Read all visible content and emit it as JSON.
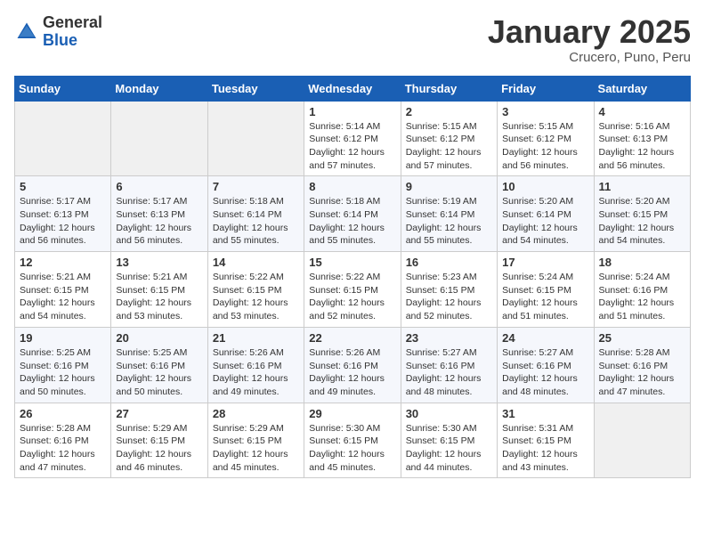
{
  "header": {
    "logo_general": "General",
    "logo_blue": "Blue",
    "title": "January 2025",
    "location": "Crucero, Puno, Peru"
  },
  "days_of_week": [
    "Sunday",
    "Monday",
    "Tuesday",
    "Wednesday",
    "Thursday",
    "Friday",
    "Saturday"
  ],
  "weeks": [
    [
      {
        "day": "",
        "info": ""
      },
      {
        "day": "",
        "info": ""
      },
      {
        "day": "",
        "info": ""
      },
      {
        "day": "1",
        "info": "Sunrise: 5:14 AM\nSunset: 6:12 PM\nDaylight: 12 hours and 57 minutes."
      },
      {
        "day": "2",
        "info": "Sunrise: 5:15 AM\nSunset: 6:12 PM\nDaylight: 12 hours and 57 minutes."
      },
      {
        "day": "3",
        "info": "Sunrise: 5:15 AM\nSunset: 6:12 PM\nDaylight: 12 hours and 56 minutes."
      },
      {
        "day": "4",
        "info": "Sunrise: 5:16 AM\nSunset: 6:13 PM\nDaylight: 12 hours and 56 minutes."
      }
    ],
    [
      {
        "day": "5",
        "info": "Sunrise: 5:17 AM\nSunset: 6:13 PM\nDaylight: 12 hours and 56 minutes."
      },
      {
        "day": "6",
        "info": "Sunrise: 5:17 AM\nSunset: 6:13 PM\nDaylight: 12 hours and 56 minutes."
      },
      {
        "day": "7",
        "info": "Sunrise: 5:18 AM\nSunset: 6:14 PM\nDaylight: 12 hours and 55 minutes."
      },
      {
        "day": "8",
        "info": "Sunrise: 5:18 AM\nSunset: 6:14 PM\nDaylight: 12 hours and 55 minutes."
      },
      {
        "day": "9",
        "info": "Sunrise: 5:19 AM\nSunset: 6:14 PM\nDaylight: 12 hours and 55 minutes."
      },
      {
        "day": "10",
        "info": "Sunrise: 5:20 AM\nSunset: 6:14 PM\nDaylight: 12 hours and 54 minutes."
      },
      {
        "day": "11",
        "info": "Sunrise: 5:20 AM\nSunset: 6:15 PM\nDaylight: 12 hours and 54 minutes."
      }
    ],
    [
      {
        "day": "12",
        "info": "Sunrise: 5:21 AM\nSunset: 6:15 PM\nDaylight: 12 hours and 54 minutes."
      },
      {
        "day": "13",
        "info": "Sunrise: 5:21 AM\nSunset: 6:15 PM\nDaylight: 12 hours and 53 minutes."
      },
      {
        "day": "14",
        "info": "Sunrise: 5:22 AM\nSunset: 6:15 PM\nDaylight: 12 hours and 53 minutes."
      },
      {
        "day": "15",
        "info": "Sunrise: 5:22 AM\nSunset: 6:15 PM\nDaylight: 12 hours and 52 minutes."
      },
      {
        "day": "16",
        "info": "Sunrise: 5:23 AM\nSunset: 6:15 PM\nDaylight: 12 hours and 52 minutes."
      },
      {
        "day": "17",
        "info": "Sunrise: 5:24 AM\nSunset: 6:15 PM\nDaylight: 12 hours and 51 minutes."
      },
      {
        "day": "18",
        "info": "Sunrise: 5:24 AM\nSunset: 6:16 PM\nDaylight: 12 hours and 51 minutes."
      }
    ],
    [
      {
        "day": "19",
        "info": "Sunrise: 5:25 AM\nSunset: 6:16 PM\nDaylight: 12 hours and 50 minutes."
      },
      {
        "day": "20",
        "info": "Sunrise: 5:25 AM\nSunset: 6:16 PM\nDaylight: 12 hours and 50 minutes."
      },
      {
        "day": "21",
        "info": "Sunrise: 5:26 AM\nSunset: 6:16 PM\nDaylight: 12 hours and 49 minutes."
      },
      {
        "day": "22",
        "info": "Sunrise: 5:26 AM\nSunset: 6:16 PM\nDaylight: 12 hours and 49 minutes."
      },
      {
        "day": "23",
        "info": "Sunrise: 5:27 AM\nSunset: 6:16 PM\nDaylight: 12 hours and 48 minutes."
      },
      {
        "day": "24",
        "info": "Sunrise: 5:27 AM\nSunset: 6:16 PM\nDaylight: 12 hours and 48 minutes."
      },
      {
        "day": "25",
        "info": "Sunrise: 5:28 AM\nSunset: 6:16 PM\nDaylight: 12 hours and 47 minutes."
      }
    ],
    [
      {
        "day": "26",
        "info": "Sunrise: 5:28 AM\nSunset: 6:16 PM\nDaylight: 12 hours and 47 minutes."
      },
      {
        "day": "27",
        "info": "Sunrise: 5:29 AM\nSunset: 6:15 PM\nDaylight: 12 hours and 46 minutes."
      },
      {
        "day": "28",
        "info": "Sunrise: 5:29 AM\nSunset: 6:15 PM\nDaylight: 12 hours and 45 minutes."
      },
      {
        "day": "29",
        "info": "Sunrise: 5:30 AM\nSunset: 6:15 PM\nDaylight: 12 hours and 45 minutes."
      },
      {
        "day": "30",
        "info": "Sunrise: 5:30 AM\nSunset: 6:15 PM\nDaylight: 12 hours and 44 minutes."
      },
      {
        "day": "31",
        "info": "Sunrise: 5:31 AM\nSunset: 6:15 PM\nDaylight: 12 hours and 43 minutes."
      },
      {
        "day": "",
        "info": ""
      }
    ]
  ]
}
